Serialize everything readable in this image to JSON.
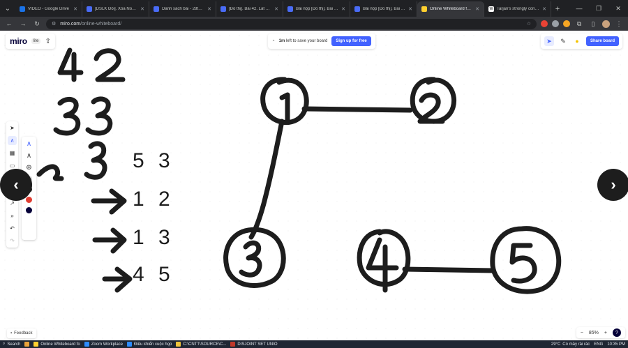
{
  "browser": {
    "tabs": [
      {
        "title": "VIDEO - Google Drive",
        "color": "#1a73e8",
        "active": false
      },
      {
        "title": "[DSLK Đôi]. Xóa Node Giữ",
        "color": "#4a6cf7",
        "active": false
      },
      {
        "title": "Danh sách bài - 28tech O",
        "color": "#4a6cf7",
        "active": false
      },
      {
        "title": "[Đồ thị]. Bài 42. Lát đường",
        "color": "#4a6cf7",
        "active": false
      },
      {
        "title": "Bài nộp [Đồ thị]. Bài 13. Đ",
        "color": "#4a6cf7",
        "active": false
      },
      {
        "title": "Bài nộp [Đồ thị]. Bài 21. Đ",
        "color": "#4a6cf7",
        "active": false
      },
      {
        "title": "Online Whiteboard for Re",
        "color": "#ffd02f",
        "active": true
      },
      {
        "title": "Tarjan's strongly connecte",
        "color": "#ffffff",
        "active": false
      }
    ],
    "url_host": "miro.com",
    "url_path": "/online-whiteboard/"
  },
  "miro": {
    "logo": "miro",
    "lite_badge": "lite",
    "save_prefix": "1m",
    "save_text": " left to save your board",
    "signup_label": "Sign up for free",
    "share_label": "Share board",
    "feedback_label": "Feedback",
    "zoom_level": "85%",
    "zoom_minus": "−",
    "zoom_plus": "+",
    "help": "?"
  },
  "board": {
    "handwritten_left": [
      "4 2",
      "3 3",
      "3"
    ],
    "typed_lines": [
      "5 3",
      "1 2",
      "1 3",
      "4 5"
    ],
    "graph_nodes": [
      "1",
      "2",
      "3",
      "4",
      "5"
    ],
    "graph_edges": [
      [
        "1",
        "2"
      ],
      [
        "1",
        "3"
      ],
      [
        "4",
        "5"
      ]
    ]
  },
  "taskbar": {
    "search_label": "Search",
    "items": [
      "Online Whiteboard fo",
      "Zoom Workplace",
      "Điều khiển cuộc họp",
      "C:\\CNTT\\SOURCE\\C...",
      "DISJOINT SET UNIO"
    ],
    "temp": "29°C",
    "weather": "Có mây rải rác",
    "lang": "ENG",
    "time": "10:35 PM"
  }
}
